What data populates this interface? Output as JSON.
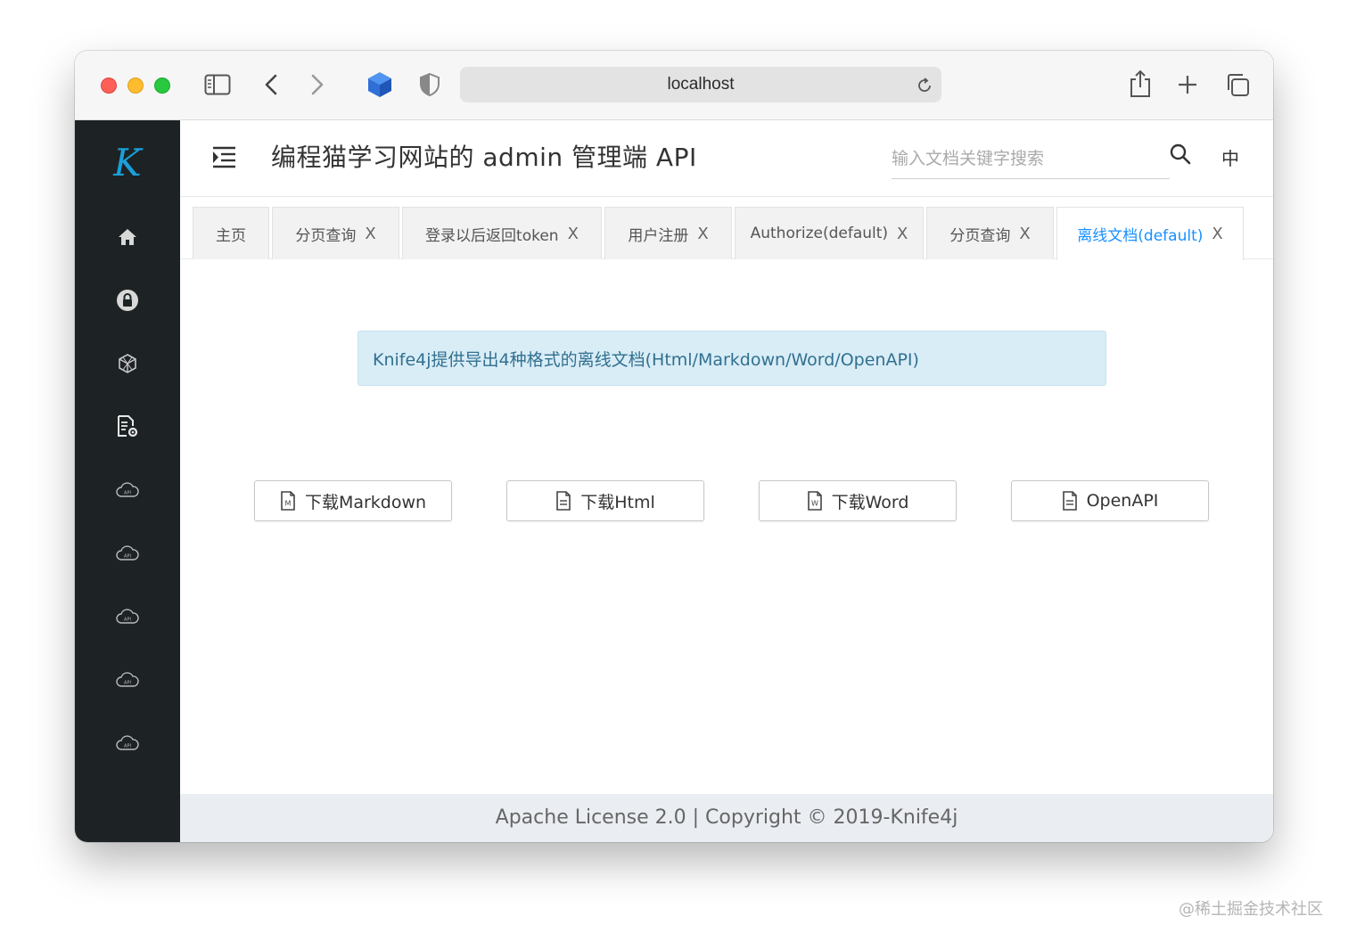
{
  "browser": {
    "address": "localhost"
  },
  "sidebar": {
    "logo_letter": "K",
    "icons": [
      "home-icon",
      "lock-icon",
      "cube-icon",
      "settings-doc-icon",
      "api-cloud-icon",
      "api-cloud-icon",
      "api-cloud-icon",
      "api-cloud-icon",
      "api-cloud-icon"
    ],
    "api_label": "API"
  },
  "header": {
    "title": "编程猫学习网站的 admin 管理端 API",
    "search_placeholder": "输入文档关键字搜索",
    "lang": "中"
  },
  "tabs": [
    {
      "label": "主页",
      "closable": false
    },
    {
      "label": "分页查询",
      "closable": true
    },
    {
      "label": "登录以后返回token",
      "closable": true
    },
    {
      "label": "用户注册",
      "closable": true
    },
    {
      "label": "Authorize(default)",
      "closable": true
    },
    {
      "label": "分页查询",
      "closable": true
    },
    {
      "label": "离线文档(default)",
      "closable": true,
      "active": true
    }
  ],
  "tab_close_glyph": "X",
  "content": {
    "alert": "Knife4j提供导出4种格式的离线文档(Html/Markdown/Word/OpenAPI)",
    "buttons": [
      {
        "label": "下载Markdown",
        "icon": "markdown-file-icon",
        "icon_letter": "M"
      },
      {
        "label": "下载Html",
        "icon": "file-text-icon",
        "icon_letter": ""
      },
      {
        "label": "下载Word",
        "icon": "word-file-icon",
        "icon_letter": "W"
      },
      {
        "label": "OpenAPI",
        "icon": "file-text-icon",
        "icon_letter": ""
      }
    ]
  },
  "footer": {
    "text": "Apache License 2.0 | Copyright © 2019-Knife4j"
  },
  "watermark": "@稀土掘金技术社区",
  "colors": {
    "sidebar_bg": "#1d2224",
    "logo": "#1a9fd9",
    "active_tab": "#1890ff",
    "alert_bg": "#d9edf7",
    "alert_text": "#31708f",
    "footer_bg": "#eaedf1"
  }
}
